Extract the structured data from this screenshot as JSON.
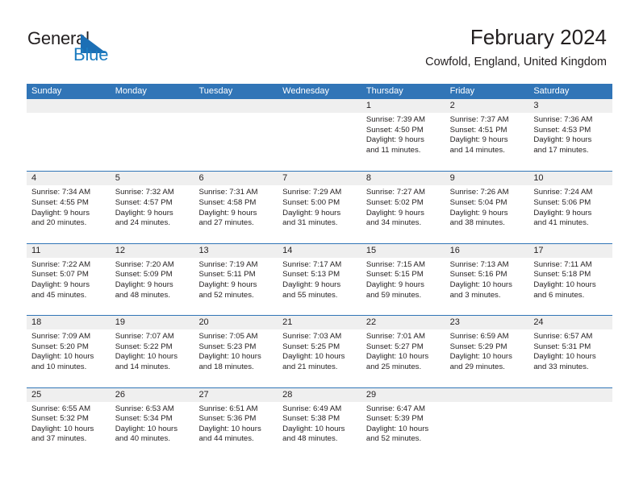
{
  "brand": {
    "name_part1": "General",
    "name_part2": "Blue",
    "logo_icon": "sail-triangle-icon",
    "accent_color": "#1c7cc0"
  },
  "header": {
    "title": "February 2024",
    "subtitle": "Cowfold, England, United Kingdom"
  },
  "colors": {
    "header_blue": "#3175b7",
    "day_band_gray": "#efefef",
    "text": "#231f20"
  },
  "weekdays": [
    "Sunday",
    "Monday",
    "Tuesday",
    "Wednesday",
    "Thursday",
    "Friday",
    "Saturday"
  ],
  "weeks": [
    [
      {
        "day": "",
        "empty": true
      },
      {
        "day": "",
        "empty": true
      },
      {
        "day": "",
        "empty": true
      },
      {
        "day": "",
        "empty": true
      },
      {
        "day": "1",
        "sunrise": "Sunrise: 7:39 AM",
        "sunset": "Sunset: 4:50 PM",
        "daylight1": "Daylight: 9 hours",
        "daylight2": "and 11 minutes."
      },
      {
        "day": "2",
        "sunrise": "Sunrise: 7:37 AM",
        "sunset": "Sunset: 4:51 PM",
        "daylight1": "Daylight: 9 hours",
        "daylight2": "and 14 minutes."
      },
      {
        "day": "3",
        "sunrise": "Sunrise: 7:36 AM",
        "sunset": "Sunset: 4:53 PM",
        "daylight1": "Daylight: 9 hours",
        "daylight2": "and 17 minutes."
      }
    ],
    [
      {
        "day": "4",
        "sunrise": "Sunrise: 7:34 AM",
        "sunset": "Sunset: 4:55 PM",
        "daylight1": "Daylight: 9 hours",
        "daylight2": "and 20 minutes."
      },
      {
        "day": "5",
        "sunrise": "Sunrise: 7:32 AM",
        "sunset": "Sunset: 4:57 PM",
        "daylight1": "Daylight: 9 hours",
        "daylight2": "and 24 minutes."
      },
      {
        "day": "6",
        "sunrise": "Sunrise: 7:31 AM",
        "sunset": "Sunset: 4:58 PM",
        "daylight1": "Daylight: 9 hours",
        "daylight2": "and 27 minutes."
      },
      {
        "day": "7",
        "sunrise": "Sunrise: 7:29 AM",
        "sunset": "Sunset: 5:00 PM",
        "daylight1": "Daylight: 9 hours",
        "daylight2": "and 31 minutes."
      },
      {
        "day": "8",
        "sunrise": "Sunrise: 7:27 AM",
        "sunset": "Sunset: 5:02 PM",
        "daylight1": "Daylight: 9 hours",
        "daylight2": "and 34 minutes."
      },
      {
        "day": "9",
        "sunrise": "Sunrise: 7:26 AM",
        "sunset": "Sunset: 5:04 PM",
        "daylight1": "Daylight: 9 hours",
        "daylight2": "and 38 minutes."
      },
      {
        "day": "10",
        "sunrise": "Sunrise: 7:24 AM",
        "sunset": "Sunset: 5:06 PM",
        "daylight1": "Daylight: 9 hours",
        "daylight2": "and 41 minutes."
      }
    ],
    [
      {
        "day": "11",
        "sunrise": "Sunrise: 7:22 AM",
        "sunset": "Sunset: 5:07 PM",
        "daylight1": "Daylight: 9 hours",
        "daylight2": "and 45 minutes."
      },
      {
        "day": "12",
        "sunrise": "Sunrise: 7:20 AM",
        "sunset": "Sunset: 5:09 PM",
        "daylight1": "Daylight: 9 hours",
        "daylight2": "and 48 minutes."
      },
      {
        "day": "13",
        "sunrise": "Sunrise: 7:19 AM",
        "sunset": "Sunset: 5:11 PM",
        "daylight1": "Daylight: 9 hours",
        "daylight2": "and 52 minutes."
      },
      {
        "day": "14",
        "sunrise": "Sunrise: 7:17 AM",
        "sunset": "Sunset: 5:13 PM",
        "daylight1": "Daylight: 9 hours",
        "daylight2": "and 55 minutes."
      },
      {
        "day": "15",
        "sunrise": "Sunrise: 7:15 AM",
        "sunset": "Sunset: 5:15 PM",
        "daylight1": "Daylight: 9 hours",
        "daylight2": "and 59 minutes."
      },
      {
        "day": "16",
        "sunrise": "Sunrise: 7:13 AM",
        "sunset": "Sunset: 5:16 PM",
        "daylight1": "Daylight: 10 hours",
        "daylight2": "and 3 minutes."
      },
      {
        "day": "17",
        "sunrise": "Sunrise: 7:11 AM",
        "sunset": "Sunset: 5:18 PM",
        "daylight1": "Daylight: 10 hours",
        "daylight2": "and 6 minutes."
      }
    ],
    [
      {
        "day": "18",
        "sunrise": "Sunrise: 7:09 AM",
        "sunset": "Sunset: 5:20 PM",
        "daylight1": "Daylight: 10 hours",
        "daylight2": "and 10 minutes."
      },
      {
        "day": "19",
        "sunrise": "Sunrise: 7:07 AM",
        "sunset": "Sunset: 5:22 PM",
        "daylight1": "Daylight: 10 hours",
        "daylight2": "and 14 minutes."
      },
      {
        "day": "20",
        "sunrise": "Sunrise: 7:05 AM",
        "sunset": "Sunset: 5:23 PM",
        "daylight1": "Daylight: 10 hours",
        "daylight2": "and 18 minutes."
      },
      {
        "day": "21",
        "sunrise": "Sunrise: 7:03 AM",
        "sunset": "Sunset: 5:25 PM",
        "daylight1": "Daylight: 10 hours",
        "daylight2": "and 21 minutes."
      },
      {
        "day": "22",
        "sunrise": "Sunrise: 7:01 AM",
        "sunset": "Sunset: 5:27 PM",
        "daylight1": "Daylight: 10 hours",
        "daylight2": "and 25 minutes."
      },
      {
        "day": "23",
        "sunrise": "Sunrise: 6:59 AM",
        "sunset": "Sunset: 5:29 PM",
        "daylight1": "Daylight: 10 hours",
        "daylight2": "and 29 minutes."
      },
      {
        "day": "24",
        "sunrise": "Sunrise: 6:57 AM",
        "sunset": "Sunset: 5:31 PM",
        "daylight1": "Daylight: 10 hours",
        "daylight2": "and 33 minutes."
      }
    ],
    [
      {
        "day": "25",
        "sunrise": "Sunrise: 6:55 AM",
        "sunset": "Sunset: 5:32 PM",
        "daylight1": "Daylight: 10 hours",
        "daylight2": "and 37 minutes."
      },
      {
        "day": "26",
        "sunrise": "Sunrise: 6:53 AM",
        "sunset": "Sunset: 5:34 PM",
        "daylight1": "Daylight: 10 hours",
        "daylight2": "and 40 minutes."
      },
      {
        "day": "27",
        "sunrise": "Sunrise: 6:51 AM",
        "sunset": "Sunset: 5:36 PM",
        "daylight1": "Daylight: 10 hours",
        "daylight2": "and 44 minutes."
      },
      {
        "day": "28",
        "sunrise": "Sunrise: 6:49 AM",
        "sunset": "Sunset: 5:38 PM",
        "daylight1": "Daylight: 10 hours",
        "daylight2": "and 48 minutes."
      },
      {
        "day": "29",
        "sunrise": "Sunrise: 6:47 AM",
        "sunset": "Sunset: 5:39 PM",
        "daylight1": "Daylight: 10 hours",
        "daylight2": "and 52 minutes."
      },
      {
        "day": "",
        "empty": true
      },
      {
        "day": "",
        "empty": true
      }
    ]
  ]
}
